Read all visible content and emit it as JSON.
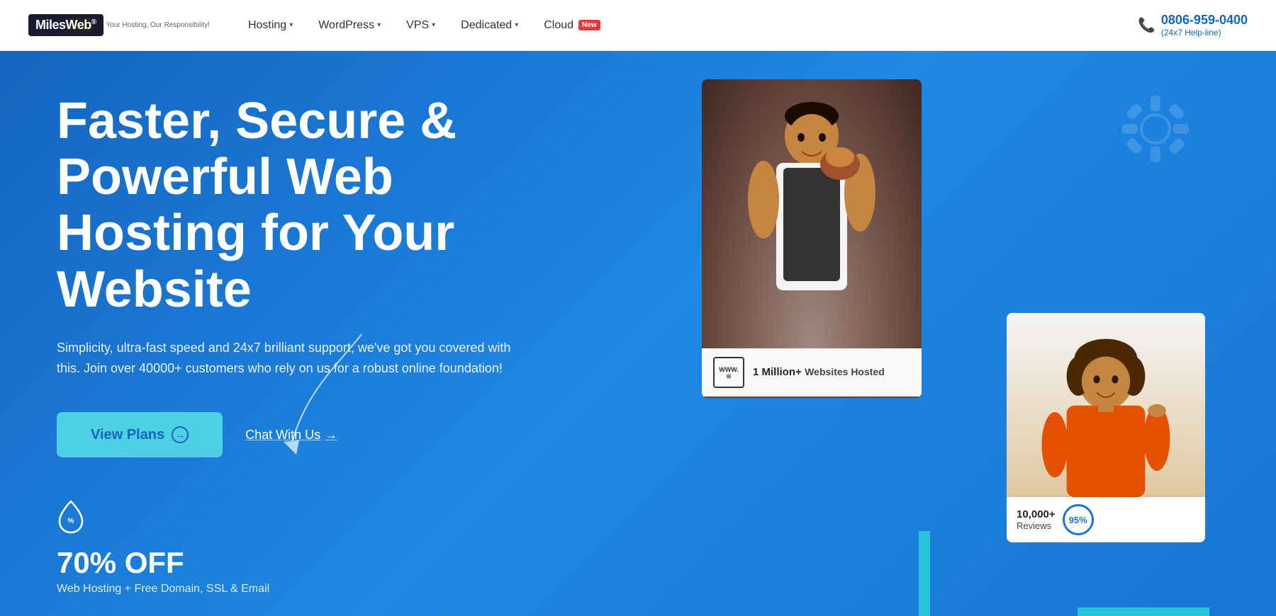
{
  "navbar": {
    "logo_miles": "Miles",
    "logo_web": "Web",
    "logo_registered": "®",
    "logo_tagline": "Your Hosting, Our Responsibility!",
    "nav_items": [
      {
        "label": "Hosting",
        "has_arrow": true
      },
      {
        "label": "WordPress",
        "has_arrow": true
      },
      {
        "label": "VPS",
        "has_arrow": true
      },
      {
        "label": "Dedicated",
        "has_arrow": true
      },
      {
        "label": "Cloud",
        "has_arrow": false,
        "badge": "New"
      }
    ],
    "phone_number": "0806-959-0400",
    "phone_sub": "(24x7 Help-line)"
  },
  "hero": {
    "title": "Faster, Secure & Powerful Web Hosting for Your Website",
    "subtitle": "Simplicity, ultra-fast speed and 24x7 brilliant support, we've got you covered with this. Join over 40000+ customers who rely on us for a robust online foundation!",
    "btn_view_plans": "View Plans",
    "btn_chat": "Chat With Us",
    "btn_chat_arrow": "→",
    "discount_pct": "70% OFF",
    "discount_desc": "Web Hosting + Free Domain, SSL & Email",
    "websites_count": "1 Million+",
    "websites_label": "Websites Hosted",
    "review_count": "10,000+",
    "review_label": "Reviews",
    "review_pct": "95%",
    "www_text": "WWW."
  }
}
